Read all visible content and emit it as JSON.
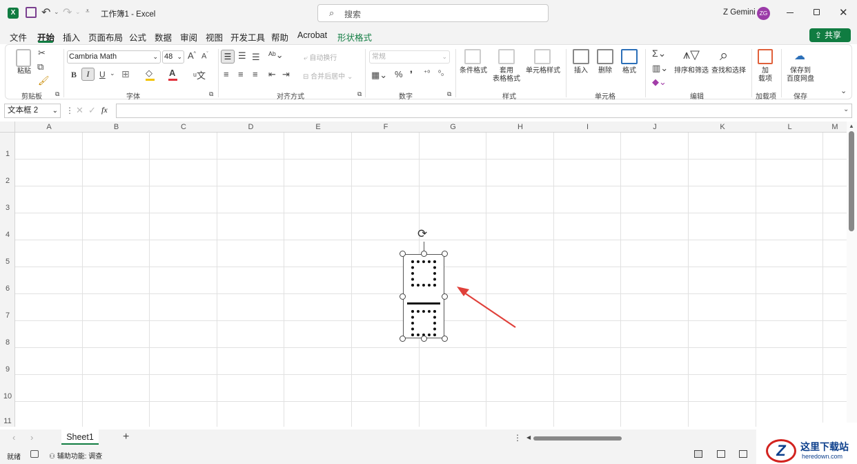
{
  "title": {
    "doc": "工作簿1",
    "sep": "-",
    "app": "Excel",
    "search_placeholder": "搜索",
    "user": "Z Gemini",
    "avatar": "ZG"
  },
  "tabs": [
    "文件",
    "开始",
    "插入",
    "页面布局",
    "公式",
    "数据",
    "审阅",
    "视图",
    "开发工具",
    "帮助",
    "Acrobat",
    "形状格式"
  ],
  "share": "共享",
  "ribbon": {
    "paste": "粘贴",
    "font_name": "Cambria Math",
    "font_size": "48",
    "wrap_text": "自动换行",
    "merge": "合并后居中",
    "number_format": "常规",
    "cond_format": "条件格式",
    "table_format_1": "套用",
    "table_format_2": "表格格式",
    "cell_style": "单元格样式",
    "insert": "插入",
    "delete": "删除",
    "format": "格式",
    "sort_filter": "排序和筛选",
    "find_select": "查找和选择",
    "addins_1": "加",
    "addins_2": "载项",
    "save_to_1": "保存到",
    "save_to_2": "百度网盘",
    "groups": {
      "clipboard": "剪贴板",
      "font": "字体",
      "align": "对齐方式",
      "number": "数字",
      "styles": "样式",
      "cells": "单元格",
      "edit": "编辑",
      "addins": "加载项",
      "save": "保存"
    },
    "bold": "B",
    "italic": "I",
    "underline": "U"
  },
  "formula_bar": {
    "name_box": "文本框 2",
    "fx": "fx",
    "value": ""
  },
  "columns": [
    "A",
    "B",
    "C",
    "D",
    "E",
    "F",
    "G",
    "H",
    "I",
    "J",
    "K",
    "L",
    "M"
  ],
  "rows": [
    "1",
    "2",
    "3",
    "4",
    "5",
    "6",
    "7",
    "8",
    "9",
    "10",
    "11"
  ],
  "sheet_tab": "Sheet1",
  "status": {
    "ready": "就绪",
    "accessibility": "辅助功能: 调查"
  },
  "watermark": {
    "cn": "这里下载站",
    "url": "heredown.com"
  },
  "colors": {
    "accent": "#107c41",
    "arrow": "#e0403a"
  }
}
